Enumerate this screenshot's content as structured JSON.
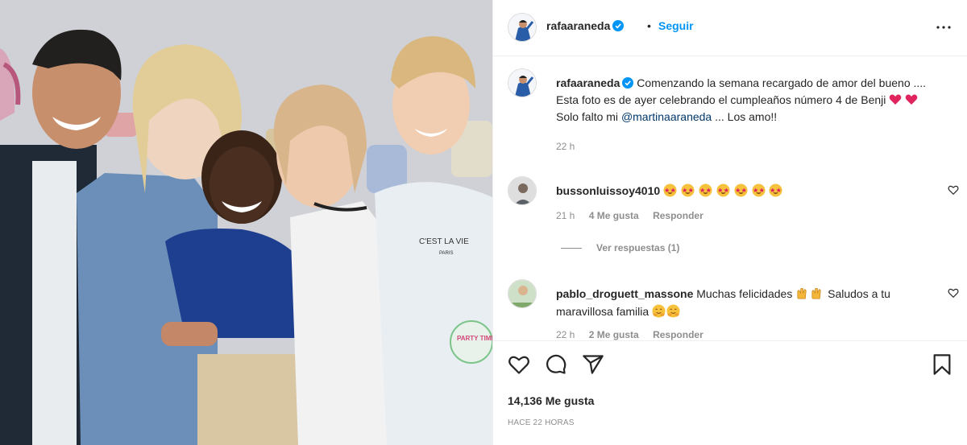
{
  "post": {
    "username": "rafaaraneda",
    "follow_dot": "•",
    "follow_label": "Seguir",
    "more_icon": "more-horizontal-icon"
  },
  "caption": {
    "username": "rafaaraneda",
    "text_part1": "Comenzando la semana recargado de amor del bueno .... Esta foto es de ayer celebrando el cumpleaños número 4 de Benji ",
    "text_part2": " Solo falto mi ",
    "mention": "@martinaaraneda",
    "text_part3": " ... Los amo!!",
    "time": "22 h"
  },
  "comments": [
    {
      "username": "bussonluissoy4010",
      "text": "",
      "emoji_count": 7,
      "time": "21 h",
      "likes": "4 Me gusta",
      "reply": "Responder"
    },
    {
      "username": "pablo_droguett_massone",
      "text_part1": "Muchas felicidades ",
      "text_part2": " Saludos a tu maravillosa familia ",
      "time": "22 h",
      "likes": "2 Me gusta",
      "reply": "Responder"
    }
  ],
  "view_replies": "Ver respuestas (1)",
  "actions": {
    "likes_count": "14,136 Me gusta",
    "posted_ago": "HACE 22 HORAS"
  },
  "photo": {
    "shirt_text_line1": "C'EST LA VIE",
    "shirt_text_line2": "PARIS",
    "balloon_text": "PARTY TIME!"
  },
  "colors": {
    "link_blue": "#0095f6",
    "mention_blue": "#00376b",
    "verified_blue": "#0095f6",
    "heart_red": "#ed4956",
    "meta_gray": "#8e8e8e"
  }
}
